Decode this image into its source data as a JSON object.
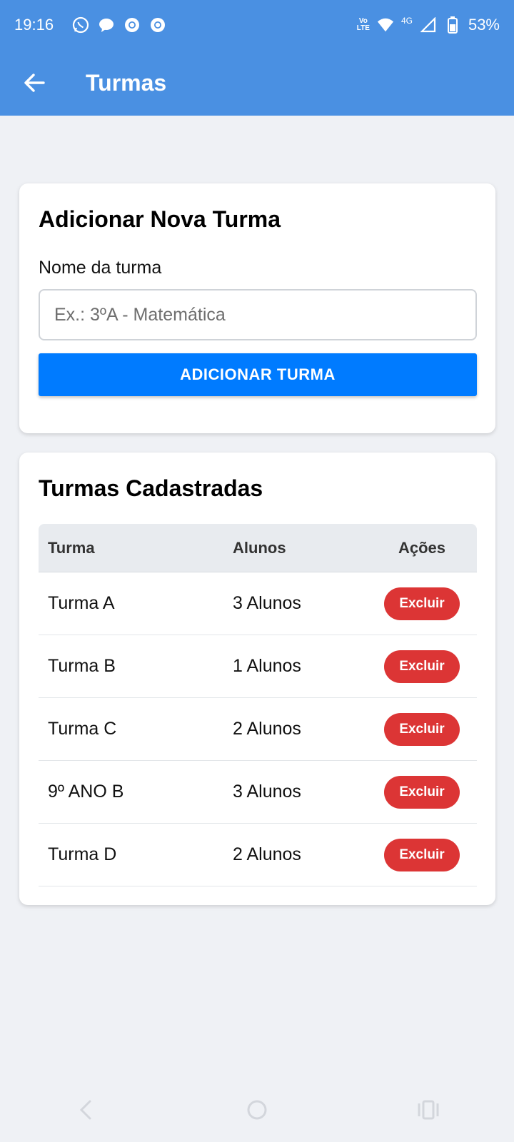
{
  "status": {
    "time": "19:16",
    "volte_top": "Vo",
    "volte_bottom": "LTE",
    "network": "4G",
    "battery": "53%"
  },
  "appbar": {
    "title": "Turmas",
    "back_icon": "arrow-left-icon"
  },
  "add_card": {
    "title": "Adicionar Nova Turma",
    "field_label": "Nome da turma",
    "input_value": "",
    "input_placeholder": "Ex.: 3ºA - Matemática",
    "button_label": "ADICIONAR TURMA"
  },
  "list_card": {
    "title": "Turmas Cadastradas",
    "columns": [
      "Turma",
      "Alunos",
      "Ações"
    ],
    "rows": [
      {
        "turma": "Turma A",
        "alunos": "3 Alunos",
        "action": "Excluir"
      },
      {
        "turma": "Turma B",
        "alunos": "1 Alunos",
        "action": "Excluir"
      },
      {
        "turma": "Turma C",
        "alunos": "2 Alunos",
        "action": "Excluir"
      },
      {
        "turma": "9º ANO B",
        "alunos": "3 Alunos",
        "action": "Excluir"
      },
      {
        "turma": "Turma D",
        "alunos": "2 Alunos",
        "action": "Excluir"
      }
    ]
  },
  "colors": {
    "header": "#4a90e2",
    "primary_button": "#007bff",
    "danger_button": "#dc3535",
    "background": "#eff1f5"
  }
}
